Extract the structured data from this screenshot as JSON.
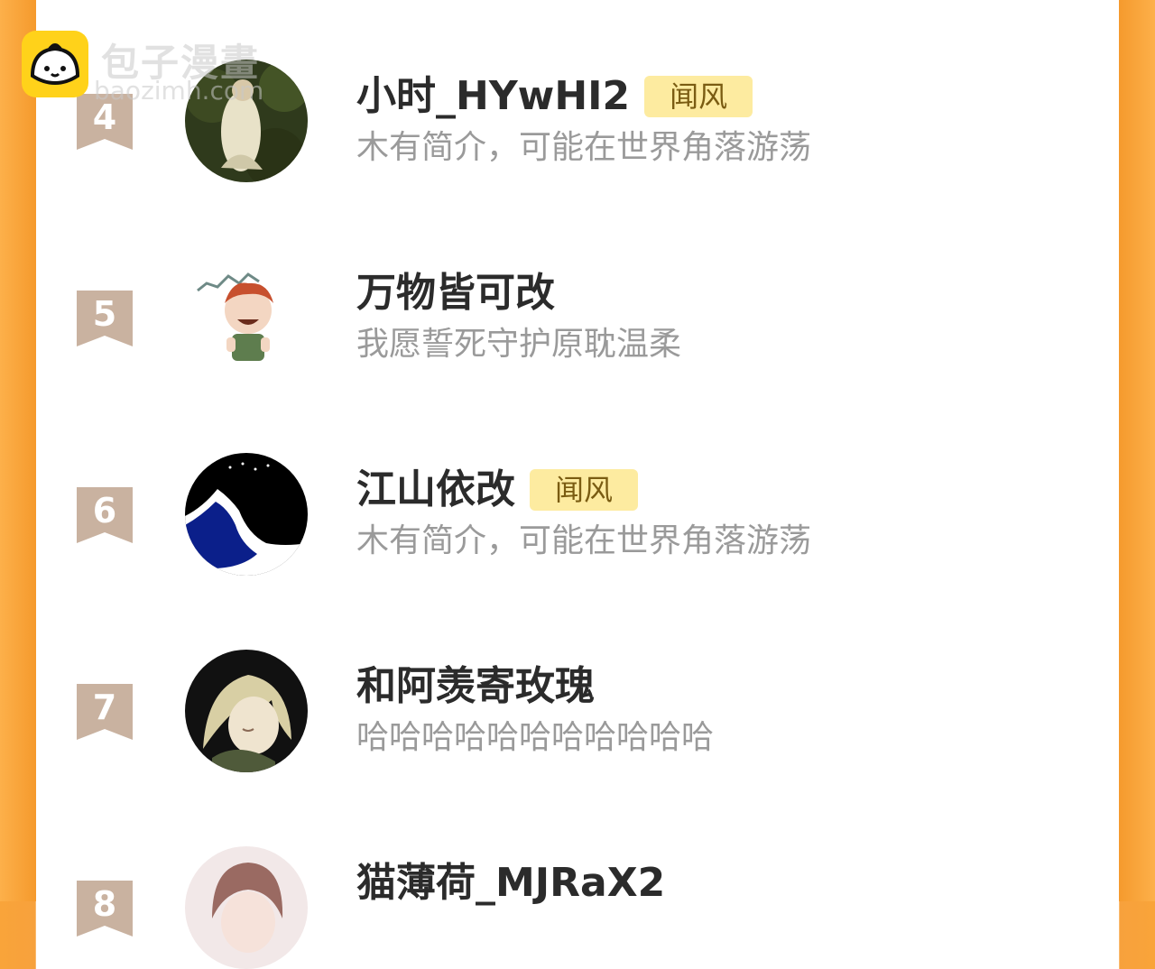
{
  "watermark": {
    "title": "包子漫畫",
    "url": "baozimh.com"
  },
  "colors": {
    "side_gradient": "#f7a13c",
    "panel": "#ffffff",
    "rank_ribbon": "#c9b2a0",
    "badge_bg": "#fdeba0",
    "badge_text": "#7a5c12",
    "name_text": "#2b2b2b",
    "bio_text": "#9a9a9a"
  },
  "list": [
    {
      "rank": "4",
      "name": "小时_HYwHI2",
      "badge": "闻风",
      "bio": "木有简介，可能在世界角落游荡",
      "avatar_icon": "woman-in-forest-avatar"
    },
    {
      "rank": "5",
      "name": "万物皆可改",
      "badge": "",
      "bio": "我愿誓死守护原耽温柔",
      "avatar_icon": "rua-boy-sticker-avatar"
    },
    {
      "rank": "6",
      "name": "江山依改",
      "badge": "闻风",
      "bio": "木有简介，可能在世界角落游荡",
      "avatar_icon": "night-sky-silhouette-avatar"
    },
    {
      "rank": "7",
      "name": "和阿羡寄玫瑰",
      "badge": "",
      "bio": "哈哈哈哈哈哈哈哈哈哈哈",
      "avatar_icon": "blonde-character-avatar"
    },
    {
      "rank": "8",
      "name": "猫薄荷_MJRaX2",
      "badge": "",
      "bio": "",
      "avatar_icon": "brown-hair-character-avatar"
    }
  ]
}
